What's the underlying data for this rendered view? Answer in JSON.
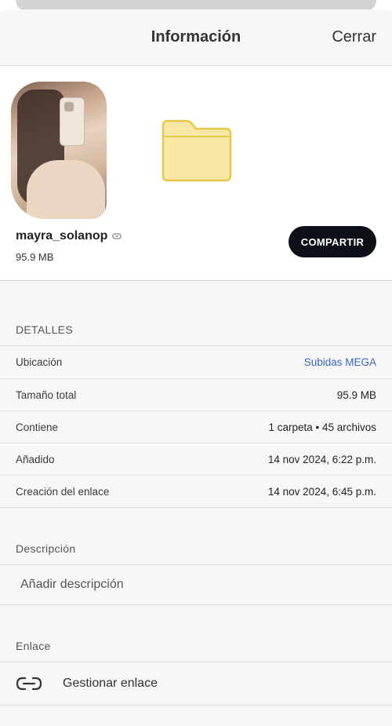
{
  "header": {
    "title": "Información",
    "close_label": "Cerrar"
  },
  "item": {
    "name": "mayra_solanop",
    "size": "95.9 MB",
    "share_label": "COMPARTIR"
  },
  "details": {
    "section_label": "DETALLES",
    "rows": [
      {
        "key": "Ubicación",
        "value": "Subidas MEGA"
      },
      {
        "key": "Tamaño total",
        "value": "95.9 MB"
      },
      {
        "key": "Contiene",
        "value": "1 carpeta • 45 archivos"
      },
      {
        "key": "Añadido",
        "value": "14 nov 2024, 6:22 p.m."
      },
      {
        "key": "Creación del enlace",
        "value": "14 nov 2024, 6:45 p.m."
      }
    ]
  },
  "description": {
    "section_label": "Descripción",
    "placeholder": "Añadir descripción"
  },
  "link": {
    "section_label": "Enlace",
    "manage_label": "Gestionar enlace"
  },
  "colors": {
    "accent_link": "#3a64c8",
    "share_button": "#0d1117",
    "folder": "#f7e6a6"
  },
  "icons": [
    "link-icon",
    "folder-icon",
    "manage-link-icon"
  ]
}
